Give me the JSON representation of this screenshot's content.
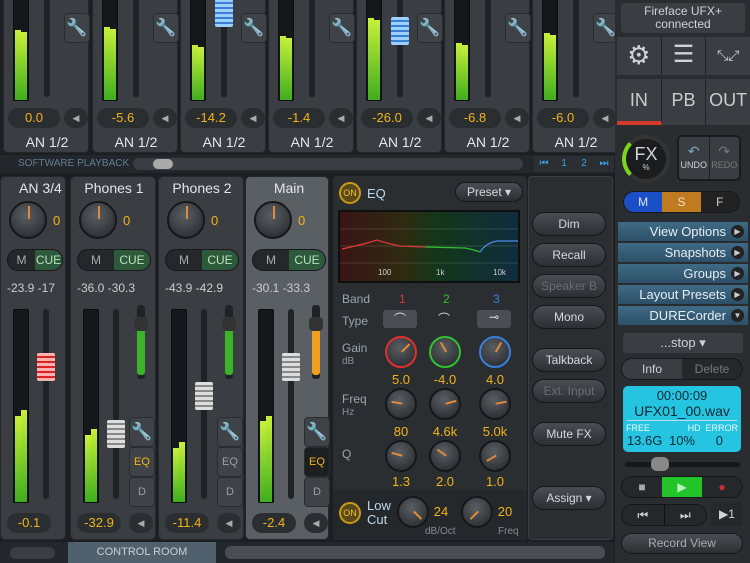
{
  "top_strips": [
    {
      "value": "0.0",
      "label": "AN 1/2",
      "level": 0.7,
      "fader": null
    },
    {
      "value": "-5.6",
      "label": "AN 1/2",
      "level": 0.73,
      "fader": null
    },
    {
      "value": "-14.2",
      "label": "AN 1/2",
      "level": 0.55,
      "fader": 0.0
    },
    {
      "value": "-1.4",
      "label": "AN 1/2",
      "level": 0.64,
      "fader": null
    },
    {
      "value": "-26.0",
      "label": "AN 1/2",
      "level": 0.82,
      "fader": 0.3
    },
    {
      "value": "-6.8",
      "label": "AN 1/2",
      "level": 0.57,
      "fader": null
    },
    {
      "value": "-6.0",
      "label": "AN 1/2",
      "level": 0.67,
      "fader": null
    }
  ],
  "section_playback": "SOFTWARE PLAYBACK",
  "pager": {
    "first": "⏮",
    "p1": "1",
    "p2": "2",
    "last": "⏭"
  },
  "bottom_strips": [
    {
      "name": "AN 3/4",
      "gain": "0",
      "mute": "M",
      "cue": "CUE",
      "peaks": "-23.9 -17",
      "value": "-0.1",
      "level": 0.45,
      "fader": 0.2,
      "fader_color": "red"
    },
    {
      "name": "Phones 1",
      "gain": "0",
      "mute": "M",
      "cue": "CUE",
      "peaks": "-36.0 -30.3",
      "value": "-32.9",
      "level": 0.35,
      "fader": 0.55,
      "eq": "EQ",
      "d": "D"
    },
    {
      "name": "Phones 2",
      "gain": "0",
      "mute": "M",
      "cue": "CUE",
      "peaks": "-43.9 -42.9",
      "value": "-11.4",
      "level": 0.28,
      "fader": 0.35,
      "eq": "EQ",
      "d": "D"
    },
    {
      "name": "Main",
      "gain": "0",
      "mute": "M",
      "cue": "CUE",
      "peaks": "-30.1 -33.3",
      "value": "-2.4",
      "level": 0.42,
      "fader": 0.2,
      "eq": "EQ",
      "d": "D"
    }
  ],
  "section_control": "CONTROL ROOM",
  "eq": {
    "on": "ON",
    "title": "EQ",
    "preset": "Preset ▾",
    "graph_ticks": [
      "100",
      "1k",
      "10k"
    ],
    "band_label": "Band",
    "bands": [
      "1",
      "2",
      "3"
    ],
    "band_colors": [
      "#e03030",
      "#30c030",
      "#3a7ee0"
    ],
    "type_label": "Type",
    "gain_label": "Gain",
    "gain_unit": "dB",
    "gains": [
      "5.0",
      "-4.0",
      "4.0"
    ],
    "freq_label": "Freq",
    "freq_unit": "Hz",
    "freqs": [
      "80",
      "4.6k",
      "5.0k"
    ],
    "q_label": "Q",
    "qs": [
      "1.3",
      "2.0",
      "1.0"
    ],
    "lowcut_on": "ON",
    "lowcut_label1": "Low",
    "lowcut_label2": "Cut",
    "slope": "24",
    "slope_unit": "dB/Oct",
    "lc_freq": "20",
    "lc_freq_unit": "Freq"
  },
  "room_buttons": {
    "dim": "Dim",
    "recall": "Recall",
    "speakerb": "Speaker B",
    "mono": "Mono",
    "talkback": "Talkback",
    "extinput": "Ext. Input",
    "mutefx": "Mute FX",
    "assign": "Assign ▾"
  },
  "sidebar": {
    "device_line1": "Fireface UFX+",
    "device_line2": "connected",
    "tabs": [
      "IN",
      "PB",
      "OUT"
    ],
    "fx": "FX",
    "fx_unit": "%",
    "undo": "UNDO",
    "redo": "REDO",
    "msf": [
      "M",
      "S",
      "F"
    ],
    "menus": [
      "View Options",
      "Snapshots",
      "Groups",
      "Layout Presets",
      "DURECorder"
    ],
    "stop": "...stop ▾",
    "info": "Info",
    "delete": "Delete",
    "rec_time": "00:00:09",
    "rec_file": "UFX01_00.wav",
    "free_label": "FREE",
    "free": "13.6G",
    "hd_label": "HD",
    "hd": "10%",
    "error_label": "ERROR",
    "error": "0",
    "loop": "▶1",
    "record_view": "Record View"
  }
}
